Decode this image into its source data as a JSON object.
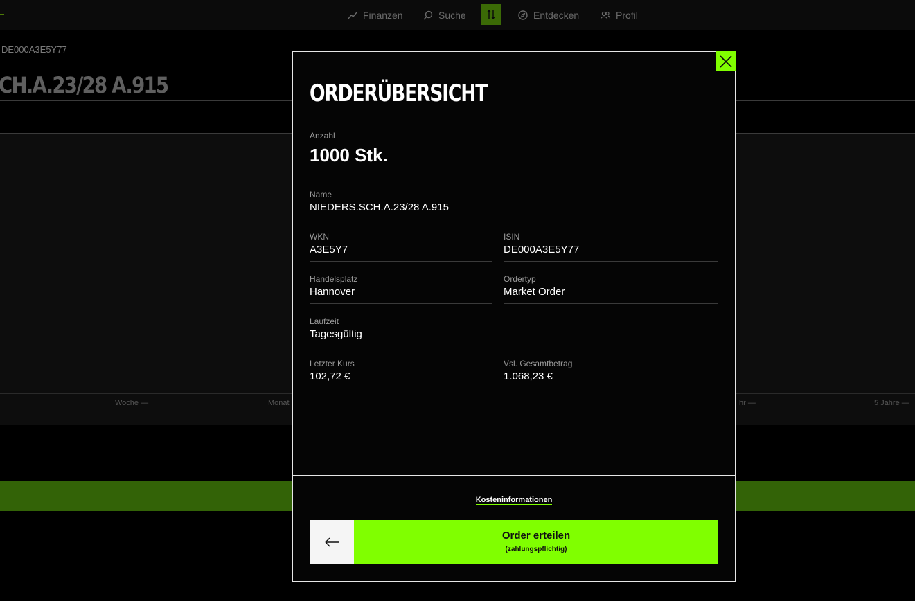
{
  "nav": {
    "items": [
      {
        "label": "Finanzen",
        "icon": "chart-icon"
      },
      {
        "label": "Suche",
        "icon": "search-icon"
      },
      {
        "label": "Entdecken",
        "icon": "compass-icon"
      },
      {
        "label": "Profil",
        "icon": "users-icon"
      }
    ],
    "active_icon": "trade-arrows-icon"
  },
  "background": {
    "isin": "DE000A3E5Y77",
    "title": "CH.A.23/28 A.915",
    "ranges": [
      "Woche —",
      "Monat",
      "hr —",
      "5 Jahre —"
    ]
  },
  "modal": {
    "title": "ORDERÜBERSICHT",
    "close_icon": "close-icon",
    "anzahl": {
      "label": "Anzahl",
      "value": "1000 Stk."
    },
    "name": {
      "label": "Name",
      "value": "NIEDERS.SCH.A.23/28 A.915"
    },
    "wkn": {
      "label": "WKN",
      "value": "A3E5Y7"
    },
    "isin": {
      "label": "ISIN",
      "value": "DE000A3E5Y77"
    },
    "handelsplatz": {
      "label": "Handelsplatz",
      "value": "Hannover"
    },
    "ordertyp": {
      "label": "Ordertyp",
      "value": "Market Order"
    },
    "laufzeit": {
      "label": "Laufzeit",
      "value": "Tagesgültig"
    },
    "letzter_kurs": {
      "label": "Letzter Kurs",
      "value": "102,72 €"
    },
    "gesamtbetrag": {
      "label": "Vsl. Gesamtbetrag",
      "value": "1.068,23 €"
    },
    "cost_link": "Kosteninformationen",
    "back_icon": "arrow-left-icon",
    "order_button": {
      "label": "Order erteilen",
      "sublabel": "(zahlungspflichtig)"
    }
  },
  "colors": {
    "accent": "#80ff00",
    "accent_dim": "#336307"
  }
}
